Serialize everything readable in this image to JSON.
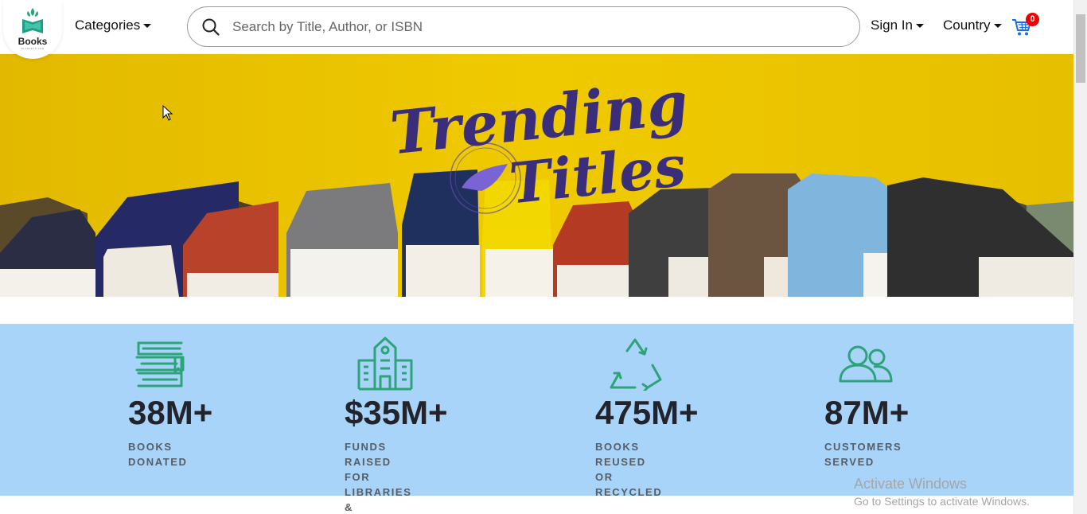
{
  "header": {
    "logo_text": "Books",
    "logo_subtext": "BLANKETS FOR",
    "categories_label": "Categories",
    "search_placeholder": "Search by Title, Author, or ISBN",
    "signin_label": "Sign In",
    "country_label": "Country",
    "cart_count": "0"
  },
  "hero": {
    "title_line1": "Trending",
    "title_line2": "Titles",
    "background_color": "#ecc600"
  },
  "stats": [
    {
      "icon": "books-stack-icon",
      "value": "38M+",
      "label_line1": "BOOKS DONATED",
      "label_line2": ""
    },
    {
      "icon": "library-building-icon",
      "value": "$35M+",
      "label_line1": "FUNDS RAISED FOR",
      "label_line2": "LIBRARIES & LITERACY"
    },
    {
      "icon": "recycle-icon",
      "value": "475M+",
      "label_line1": "BOOKS REUSED",
      "label_line2": "OR RECYCLED"
    },
    {
      "icon": "customers-icon",
      "value": "87M+",
      "label_line1": "CUSTOMERS SERVED",
      "label_line2": ""
    }
  ],
  "colors": {
    "accent_green": "#2ea37a",
    "stats_background": "#a8d4fa",
    "title_purple": "#3a2d7a",
    "cart_blue": "#1d6fe0",
    "badge_red": "#e00000"
  },
  "watermark": {
    "line1": "Activate Windows",
    "line2": "Go to Settings to activate Windows."
  }
}
